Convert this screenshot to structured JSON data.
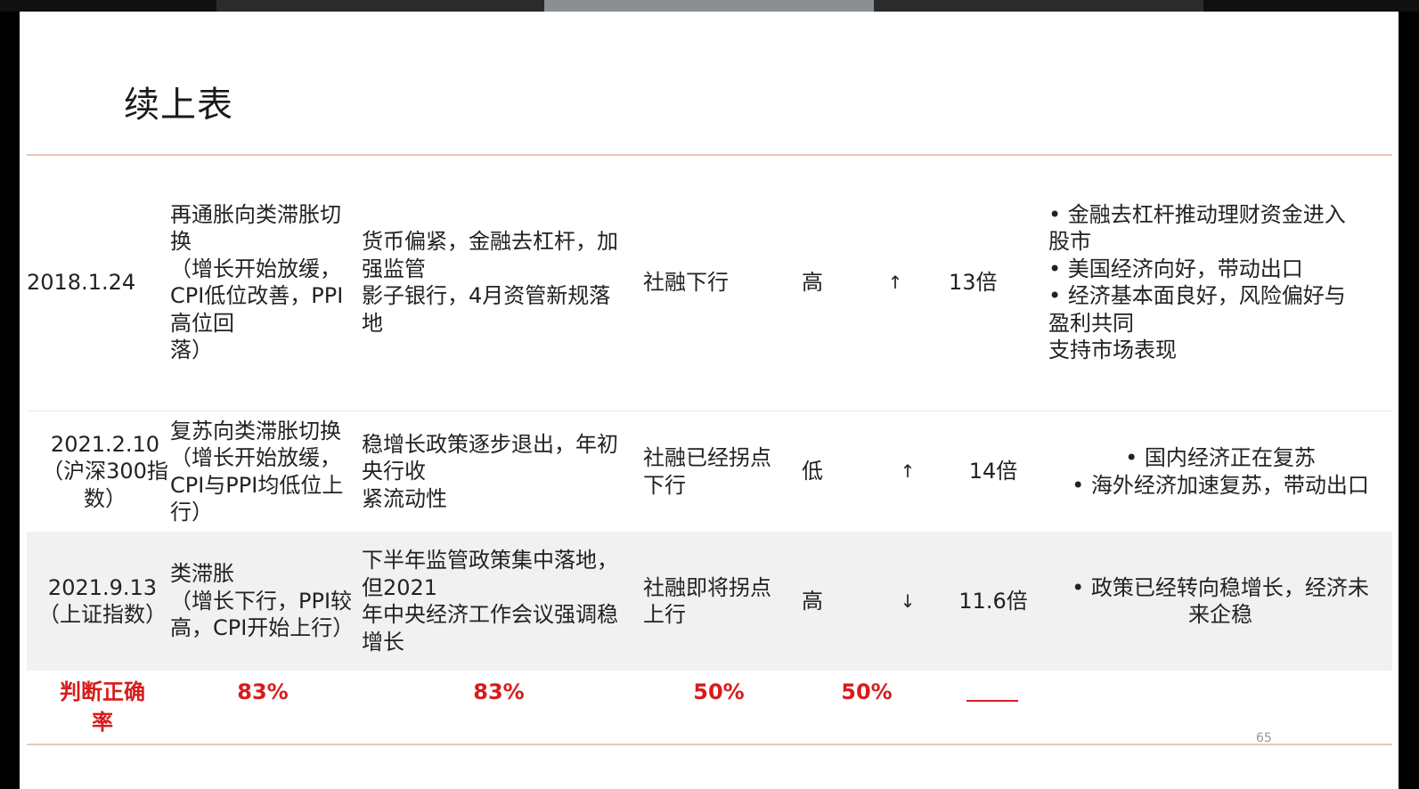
{
  "slide": {
    "title": "续上表",
    "page_number": "65"
  },
  "rows": [
    {
      "date": [
        "2018.1.24"
      ],
      "phase": [
        "再通胀向类滞胀切",
        "换",
        "（增长开始放缓，",
        "CPI低位改善，PPI",
        "高位回",
        "落）"
      ],
      "policy": [
        "货币偏紧，金融去杠杆，加",
        "强监管",
        "影子银行，4月资管新规落",
        "地"
      ],
      "credit": [
        "社融下行"
      ],
      "level": "高",
      "arrow": "↑",
      "multiple": "13倍",
      "reasons": [
        "• 金融去杠杆推动理财资金进入",
        "股市",
        "• 美国经济向好，带动出口",
        "• 经济基本面良好，风险偏好与",
        "盈利共同",
        "支持市场表现"
      ]
    },
    {
      "date": [
        "2021.2.10",
        "（沪深300指",
        "数）"
      ],
      "phase": [
        "复苏向类滞胀切换",
        "（增长开始放缓，",
        "CPI与PPI均低位上",
        "行）"
      ],
      "policy": [
        "稳增长政策逐步退出，年初",
        "央行收",
        "紧流动性"
      ],
      "credit": [
        "社融已经拐点",
        "下行"
      ],
      "level": "低",
      "arrow": "↑",
      "multiple": "14倍",
      "reasons": [
        "• 国内经济正在复苏",
        "• 海外经济加速复苏，带动出口"
      ]
    },
    {
      "date": [
        "2021.9.13",
        "（上证指数）"
      ],
      "phase": [
        "类滞胀",
        "（增长下行，PPI较",
        "高，CPI开始上行）"
      ],
      "policy": [
        "下半年监管政策集中落地，",
        "但2021",
        "年中央经济工作会议强调稳",
        "增长"
      ],
      "credit": [
        "社融即将拐点",
        "上行"
      ],
      "level": "高",
      "arrow": "↓",
      "multiple": "11.6倍",
      "reasons": [
        "• 政策已经转向稳增长，经济未",
        "来企稳"
      ]
    }
  ],
  "accuracy": {
    "label": [
      "判断正确",
      "率"
    ],
    "values": [
      "83%",
      "83%",
      "50%",
      "50%"
    ]
  },
  "colors": {
    "accent_red": "#d71c1c",
    "rule": "#e8c9b4",
    "row_alt_bg": "#f1f1f1"
  }
}
